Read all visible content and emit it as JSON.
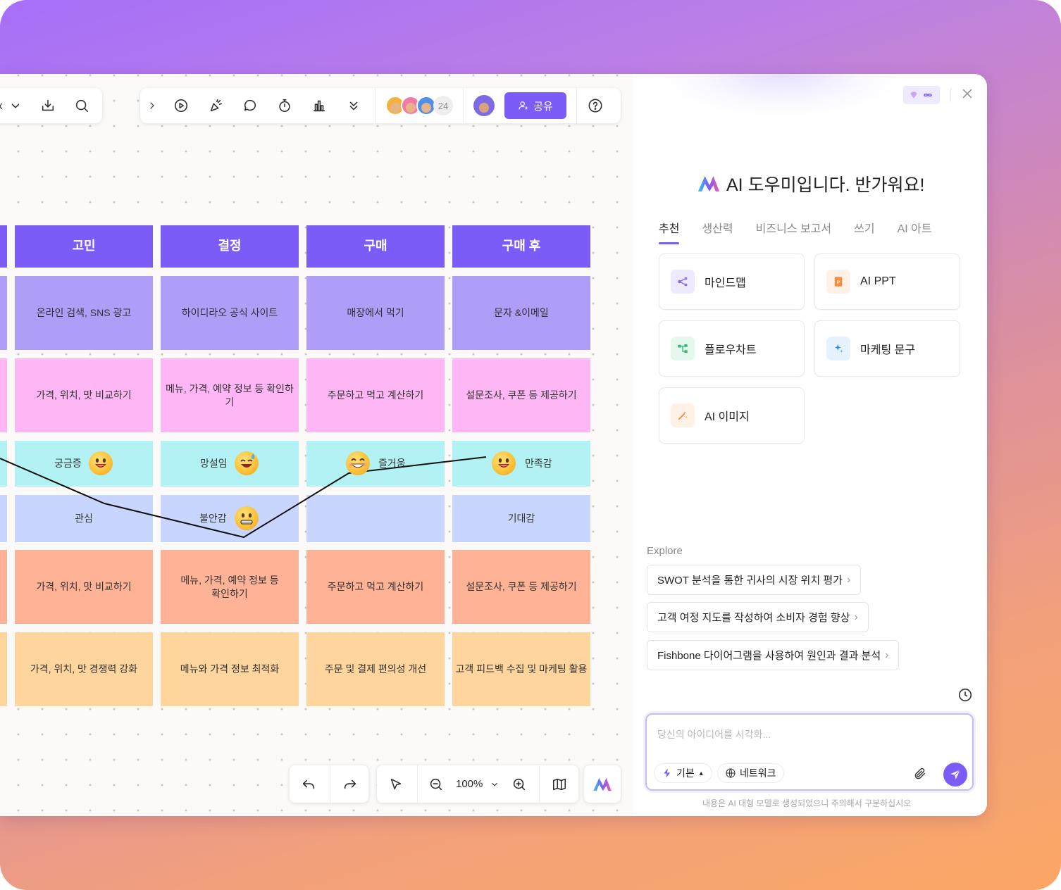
{
  "colors": {
    "accent": "#7b5cf7",
    "row_purple": "#b09df7",
    "row_pink": "#feb6f4",
    "row_cyan": "#b2f1f4",
    "row_lavender": "#c8d5fe",
    "row_salmon": "#feb396",
    "row_peach": "#fed59d"
  },
  "toolbar": {
    "left_partial_label": "x",
    "icons": [
      "chevron-down-icon",
      "download-icon",
      "search-icon",
      "chevron-right-icon",
      "play-icon",
      "celebrate-icon",
      "comment-icon",
      "timer-icon",
      "vote-icon",
      "more-icon",
      "help-icon"
    ],
    "collaborator_count": "24",
    "share_label": "공유"
  },
  "journey": {
    "headers": [
      "고민",
      "결정",
      "구매",
      "구매 후"
    ],
    "rows": [
      [
        "온라인 검색, SNS 광고",
        "하이디라오 공식 사이트",
        "매장에서 먹기",
        "문자 &이메일"
      ],
      [
        "가격, 위치, 맛 비교하기",
        "메뉴, 가격, 예약 정보 등 확인하기",
        "주문하고 먹고 계산하기",
        "설문조사, 쿠폰 등 제공하기"
      ],
      [
        "궁금증",
        "망설임",
        "즐거움",
        "만족감"
      ],
      [
        "관심",
        "불안감",
        "",
        "기대감"
      ],
      [
        "가격, 위치, 맛 비교하기",
        "메뉴, 가격, 예약 정보 등 확인하기",
        "주문하고 먹고 계산하기",
        "설문조사, 쿠폰 등 제공하기"
      ],
      [
        "가격, 위치, 맛 경쟁력 강화",
        "메뉴와 가격 정보 최적화",
        "주문 및 결제 편의성 개선",
        "고객 피드백 수집 및 마케팅 활용"
      ]
    ]
  },
  "bottom_toolbar": {
    "zoom": "100%",
    "icons": [
      "undo-icon",
      "redo-icon",
      "select-icon",
      "zoom-out-icon",
      "zoom-in-icon",
      "map-icon",
      "ai-logo-icon"
    ]
  },
  "ai_panel": {
    "welcome": "AI 도우미입니다. 반가워요!",
    "tabs": [
      "추천",
      "생산력",
      "비즈니스 보고서",
      "쓰기",
      "AI 아트"
    ],
    "active_tab": "추천",
    "cards": [
      "마인드맵",
      "AI PPT",
      "플로우차트",
      "마케팅 문구",
      "AI 이미지"
    ],
    "explore_heading": "Explore",
    "explore_items": [
      "SWOT 분석을 통한 귀사의 시장 위치 평가",
      "고객 여정 지도를 작성하여 소비자 경험 향상",
      "Fishbone 다이어그램을 사용하여 원인과 결과 분석"
    ],
    "input_placeholder": "당신의 아이디어를 시각화...",
    "mode_label": "기본",
    "network_label": "네트워크",
    "disclaimer": "내용은 AI 대형 모델로 생성되었으니 주의해서 구분하십시오"
  }
}
